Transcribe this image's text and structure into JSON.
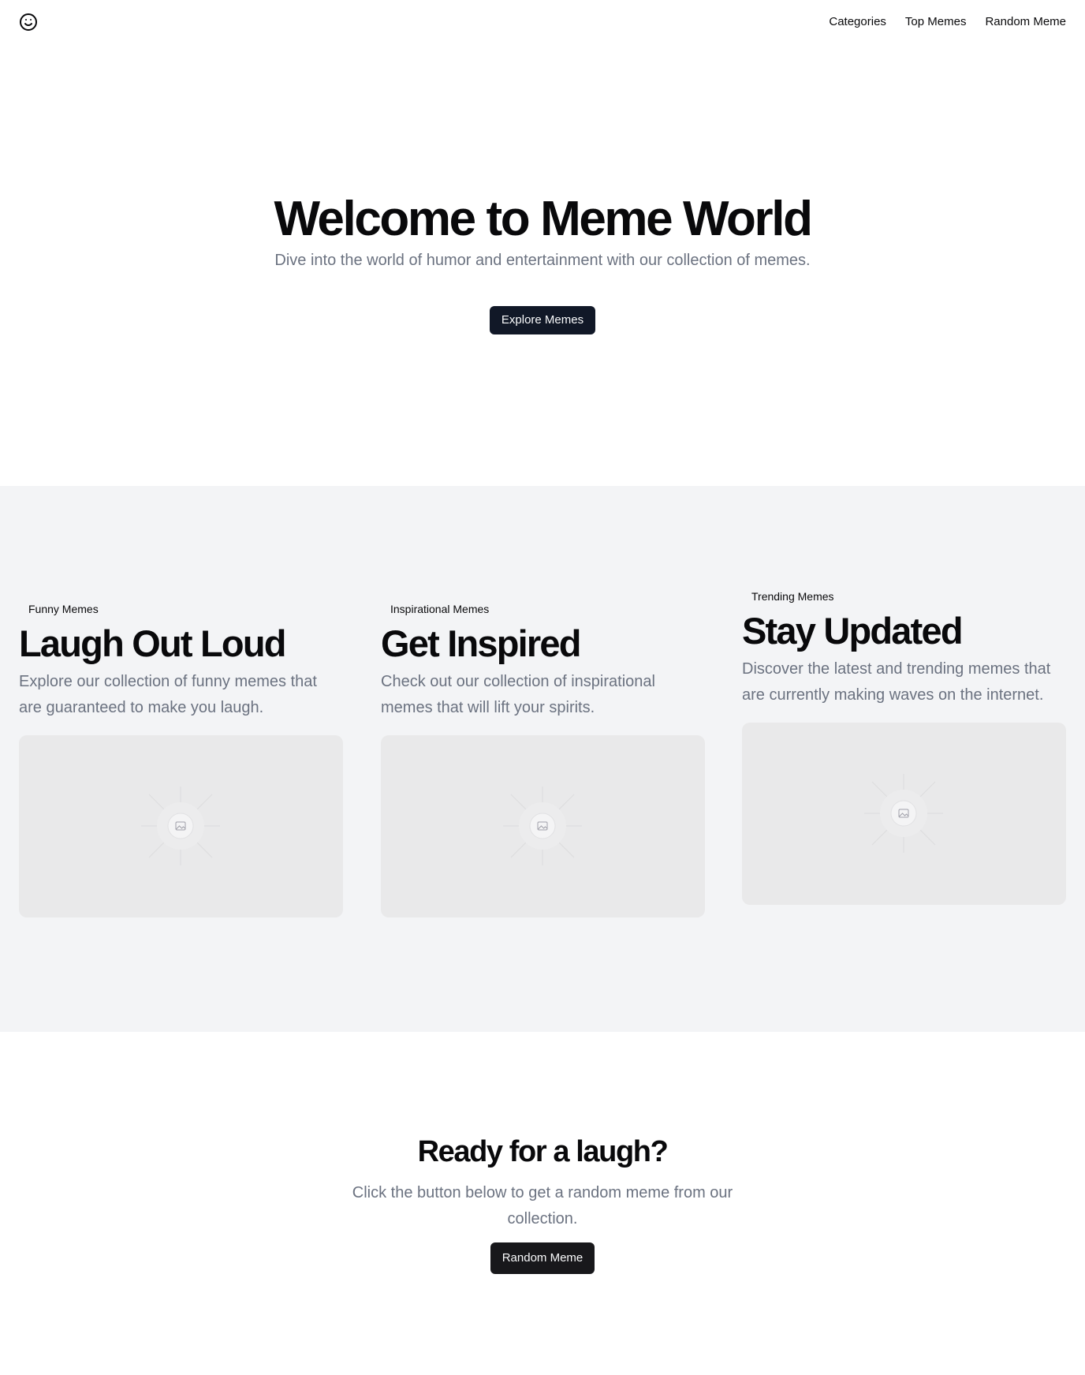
{
  "header": {
    "logo_icon": "smiley-face-icon",
    "nav": [
      {
        "label": "Categories"
      },
      {
        "label": "Top Memes"
      },
      {
        "label": "Random Meme"
      }
    ]
  },
  "hero": {
    "title": "Welcome to Meme World",
    "subtitle": "Dive into the world of humor and entertainment with our collection of memes.",
    "button": "Explore Memes"
  },
  "features": [
    {
      "tag": "Funny Memes",
      "title": "Laugh Out Loud",
      "description": "Explore our collection of funny memes that are guaranteed to make you laugh.",
      "image_icon": "image-placeholder-icon"
    },
    {
      "tag": "Inspirational Memes",
      "title": "Get Inspired",
      "description": "Check out our collection of inspirational memes that will lift your spirits.",
      "image_icon": "image-placeholder-icon"
    },
    {
      "tag": "Trending Memes",
      "title": "Stay Updated",
      "description": "Discover the latest and trending memes that are currently making waves on the internet.",
      "image_icon": "image-placeholder-icon"
    }
  ],
  "cta": {
    "title": "Ready for a laugh?",
    "subtitle": "Click the button below to get a random meme from our collection.",
    "button": "Random Meme"
  },
  "colors": {
    "primary_button": "#111827",
    "section_bg": "#f3f4f6",
    "muted_text": "#6b7280"
  }
}
